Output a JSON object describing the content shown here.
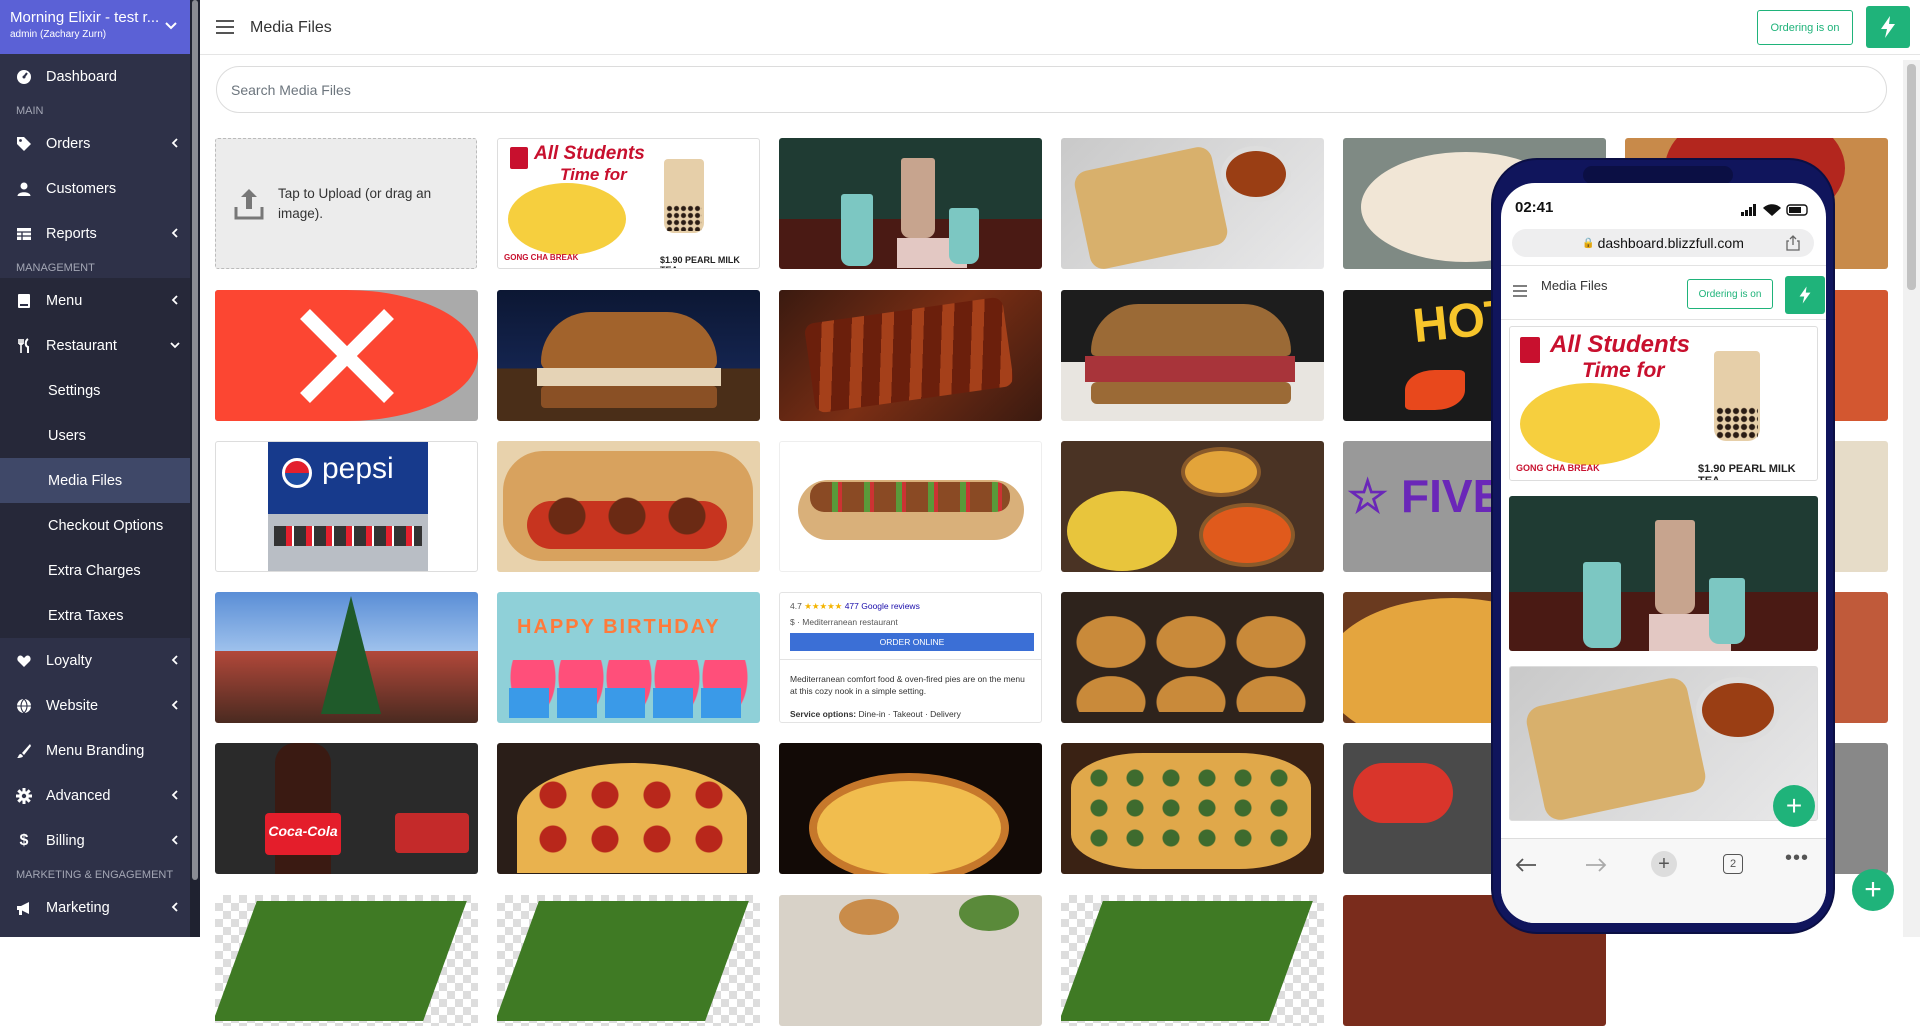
{
  "brand": {
    "title": "Morning Elixir - test r...",
    "subtitle": "admin (Zachary Zurn)"
  },
  "sidebar": {
    "dashboard": "Dashboard",
    "sec_main": "MAIN",
    "orders": "Orders",
    "customers": "Customers",
    "reports": "Reports",
    "sec_management": "MANAGEMENT",
    "menu": "Menu",
    "restaurant": "Restaurant",
    "settings": "Settings",
    "users": "Users",
    "media_files": "Media Files",
    "checkout_options": "Checkout Options",
    "extra_charges": "Extra Charges",
    "extra_taxes": "Extra Taxes",
    "loyalty": "Loyalty",
    "website": "Website",
    "menu_branding": "Menu Branding",
    "advanced": "Advanced",
    "billing": "Billing",
    "sec_marketing": "MARKETING & ENGAGEMENT",
    "marketing": "Marketing"
  },
  "header": {
    "title": "Media Files",
    "ordering_label": "Ordering is on"
  },
  "search": {
    "placeholder": "Search Media Files"
  },
  "upload": {
    "label": "Tap to Upload (or drag an image)."
  },
  "tiles": {
    "gongcha": {
      "headline1": "All Students",
      "headline2": "Time for",
      "break": "GONG CHA BREAK",
      "price": "$1.90 PEARL MILK TEA"
    },
    "pepsi": "pepsi",
    "hot": "HOT",
    "five": "FIVE",
    "birthday": "HAPPY BIRTHDAY",
    "coke": "Coca-Cola",
    "google": {
      "rating": "4.7",
      "stars": "★★★★★",
      "reviews": "477 Google reviews",
      "category": "$ · Mediterranean restaurant",
      "button": "ORDER ONLINE",
      "desc": "Mediterranean comfort food & oven-fired pies are on the menu at this cozy nook in a simple setting.",
      "service_label": "Service options:",
      "service_value": "Dine-in · Takeout · Delivery"
    }
  },
  "phone": {
    "time": "02:41",
    "url": "dashboard.blizzfull.com",
    "title": "Media Files",
    "ordering_label": "Ordering is on",
    "tab_count": "2"
  },
  "colors": {
    "accent": "#1fb37a",
    "sidebar": "#2e3148",
    "brand": "#5b61d6"
  }
}
